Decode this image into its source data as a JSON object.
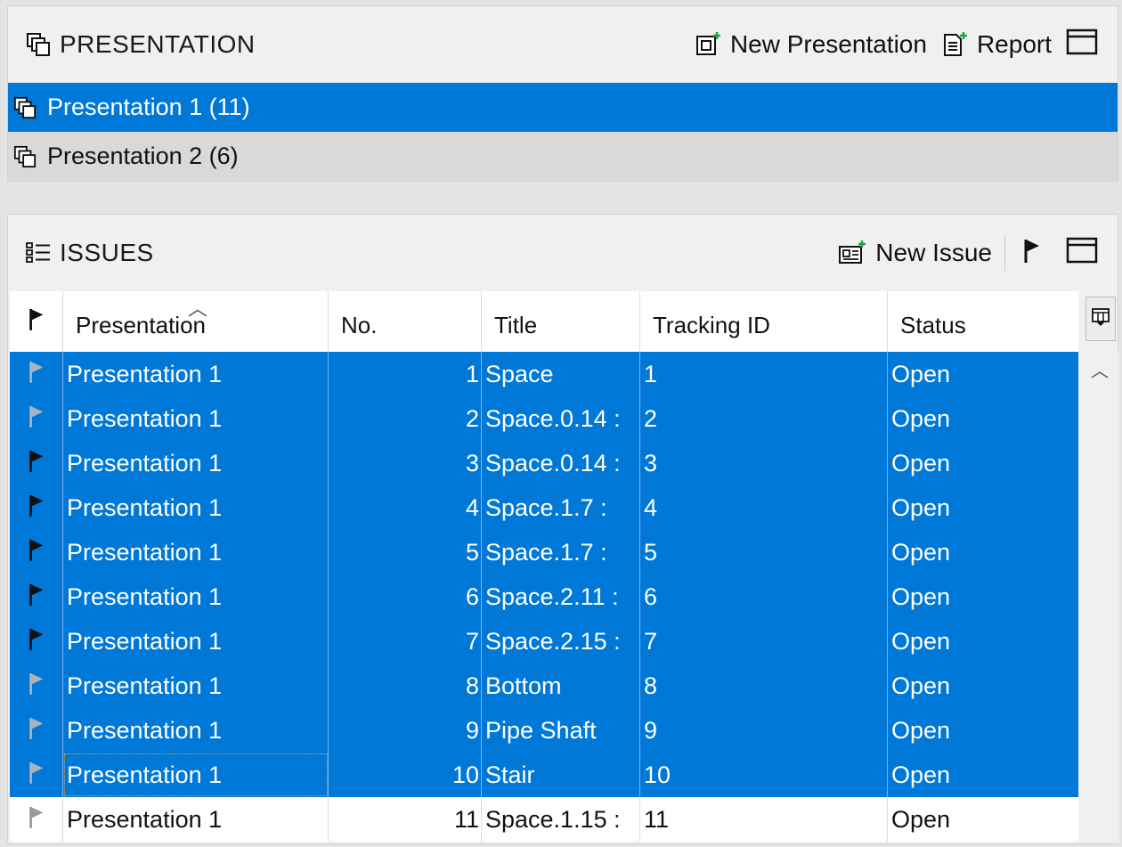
{
  "presentation_panel": {
    "title": "PRESENTATION",
    "title_icon": "presentation-stack-icon",
    "toolbar": {
      "new_presentation_label": "New Presentation",
      "report_label": "Report"
    },
    "items": [
      {
        "label": "Presentation 1 (11)",
        "selected": true
      },
      {
        "label": "Presentation 2 (6)",
        "selected": false
      }
    ]
  },
  "issues_panel": {
    "title": "ISSUES",
    "title_icon": "list-icon",
    "toolbar": {
      "new_issue_label": "New Issue"
    },
    "columns": [
      "Presentation",
      "No.",
      "Title",
      "Tracking ID",
      "Status"
    ],
    "sorted_column": "Presentation",
    "rows": [
      {
        "flag": "gray",
        "presentation": "Presentation 1",
        "no": "1",
        "title": "Space",
        "tracking_id": "1",
        "status": "Open",
        "selected": true
      },
      {
        "flag": "gray",
        "presentation": "Presentation 1",
        "no": "2",
        "title": "Space.0.14 :",
        "tracking_id": "2",
        "status": "Open",
        "selected": true
      },
      {
        "flag": "black",
        "presentation": "Presentation 1",
        "no": "3",
        "title": "Space.0.14 :",
        "tracking_id": "3",
        "status": "Open",
        "selected": true
      },
      {
        "flag": "black",
        "presentation": "Presentation 1",
        "no": "4",
        "title": "Space.1.7 :",
        "tracking_id": "4",
        "status": "Open",
        "selected": true
      },
      {
        "flag": "black",
        "presentation": "Presentation 1",
        "no": "5",
        "title": "Space.1.7 :",
        "tracking_id": "5",
        "status": "Open",
        "selected": true
      },
      {
        "flag": "black",
        "presentation": "Presentation 1",
        "no": "6",
        "title": "Space.2.11 :",
        "tracking_id": "6",
        "status": "Open",
        "selected": true
      },
      {
        "flag": "black",
        "presentation": "Presentation 1",
        "no": "7",
        "title": "Space.2.15 :",
        "tracking_id": "7",
        "status": "Open",
        "selected": true
      },
      {
        "flag": "gray",
        "presentation": "Presentation 1",
        "no": "8",
        "title": "Bottom",
        "tracking_id": "8",
        "status": "Open",
        "selected": true
      },
      {
        "flag": "gray",
        "presentation": "Presentation 1",
        "no": "9",
        "title": "Pipe Shaft",
        "tracking_id": "9",
        "status": "Open",
        "selected": true
      },
      {
        "flag": "gray",
        "presentation": "Presentation 1",
        "no": "10",
        "title": "Stair",
        "tracking_id": "10",
        "status": "Open",
        "selected": true,
        "focused": true
      },
      {
        "flag": "light",
        "presentation": "Presentation 1",
        "no": "11",
        "title": "Space.1.15 :",
        "tracking_id": "11",
        "status": "Open",
        "selected": false
      }
    ]
  },
  "colors": {
    "selection": "#0078d7",
    "flag_black": "#111111",
    "flag_gray_on_blue": "#a9b4be",
    "flag_light": "#9a9a9a"
  }
}
